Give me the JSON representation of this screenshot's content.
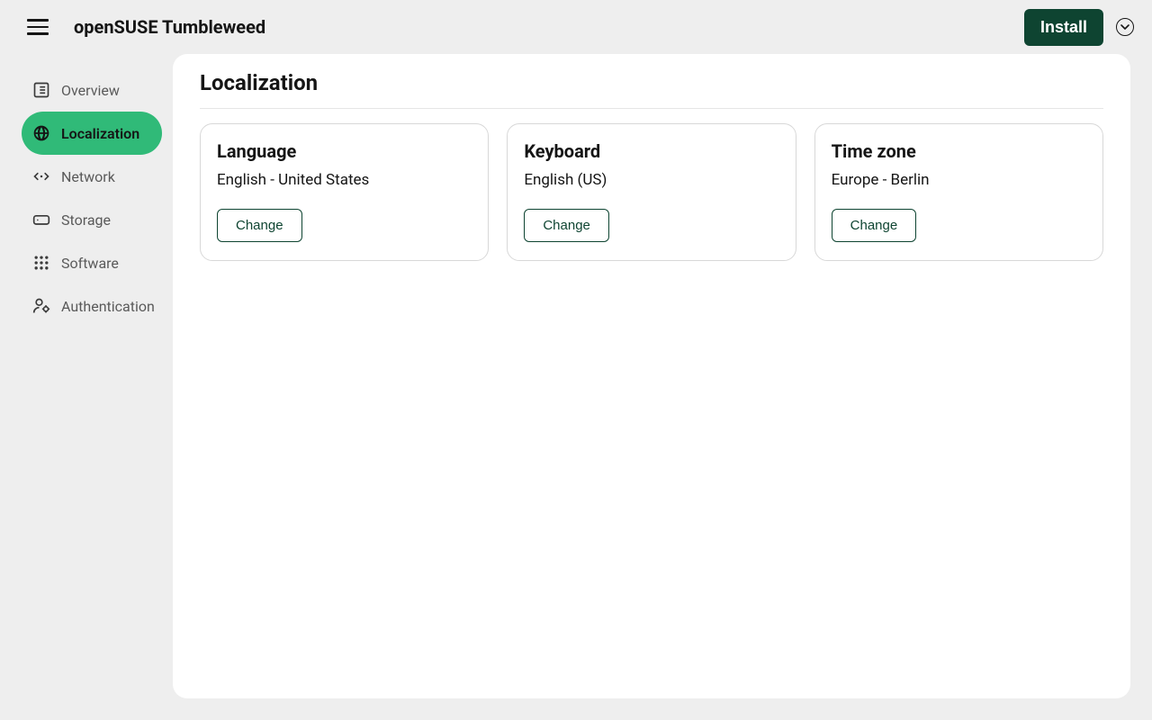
{
  "header": {
    "title": "openSUSE Tumbleweed",
    "install_label": "Install"
  },
  "sidebar": {
    "items": [
      {
        "label": "Overview",
        "icon": "overview"
      },
      {
        "label": "Localization",
        "icon": "globe",
        "active": true
      },
      {
        "label": "Network",
        "icon": "network"
      },
      {
        "label": "Storage",
        "icon": "storage"
      },
      {
        "label": "Software",
        "icon": "software"
      },
      {
        "label": "Authentication",
        "icon": "auth"
      }
    ]
  },
  "page": {
    "title": "Localization",
    "change_label": "Change",
    "cards": [
      {
        "title": "Language",
        "value": "English - United States"
      },
      {
        "title": "Keyboard",
        "value": "English (US)"
      },
      {
        "title": "Time zone",
        "value": "Europe - Berlin"
      }
    ]
  }
}
